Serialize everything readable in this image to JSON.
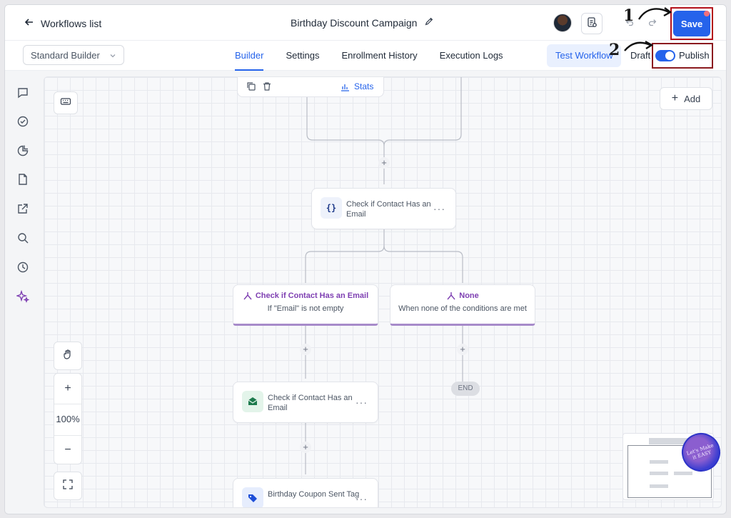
{
  "header": {
    "back_label": "Workflows list",
    "title": "Birthday Discount Campaign",
    "save_label": "Save"
  },
  "subbar": {
    "builder_select": "Standard Builder",
    "tabs": [
      {
        "label": "Builder",
        "active": true
      },
      {
        "label": "Settings",
        "active": false
      },
      {
        "label": "Enrollment History",
        "active": false
      },
      {
        "label": "Execution Logs",
        "active": false
      }
    ],
    "test_label": "Test Workflow",
    "draft_label": "Draft",
    "publish_label": "Publish",
    "publish_on": true
  },
  "annotations": {
    "step1": "1",
    "step2": "2",
    "highlight_color": "#b4121b"
  },
  "rail_icons": [
    "chat-icon",
    "check-circle-icon",
    "pie-chart-icon",
    "document-icon",
    "external-link-icon",
    "search-icon",
    "history-icon",
    "sparkles-icon"
  ],
  "canvas": {
    "add_label": "Add",
    "zoom_level": "100%",
    "stats_label": "Stats",
    "nodes": {
      "check_email_action": "Check if Contact Has an Email",
      "branch_true_title": "Check if Contact Has an Email",
      "branch_true_sub": "If \"Email\" is not empty",
      "branch_none_title": "None",
      "branch_none_sub": "When none of the conditions are met",
      "email_node": "Check if Contact Has an Email",
      "tag_node": "Birthday Coupon Sent Tag",
      "end_label": "END"
    },
    "logo_text": "Let's Make it EASY"
  },
  "colors": {
    "accent": "#2563eb",
    "branch_purple": "#7e3fb2",
    "email_green": "#1d7a4d",
    "tag_blue": "#1d4ed8"
  }
}
